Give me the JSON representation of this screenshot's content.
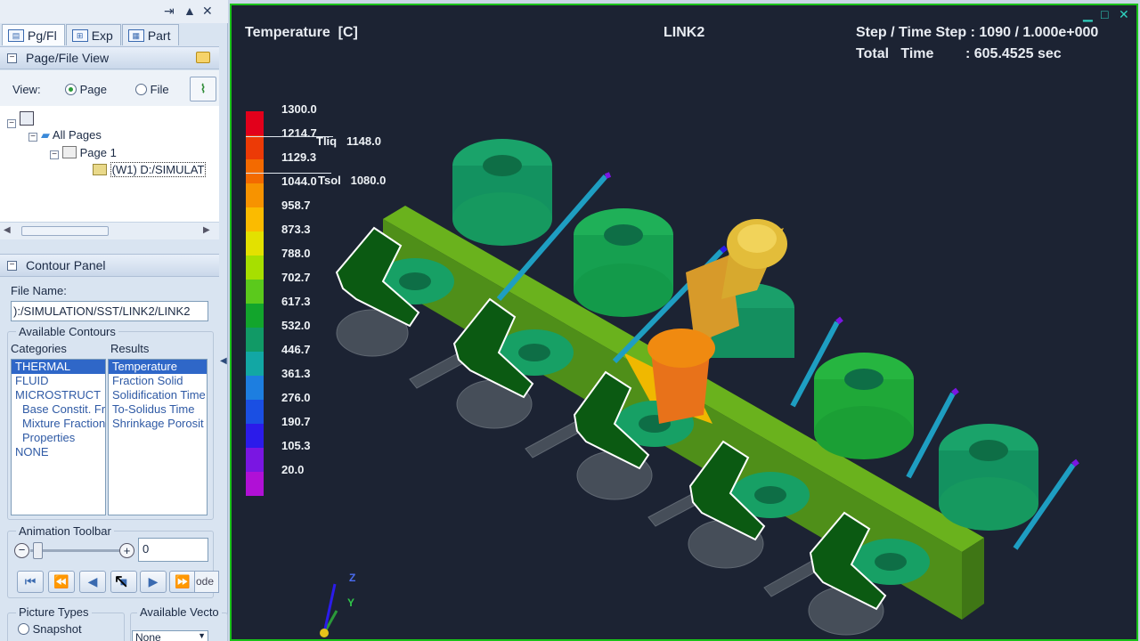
{
  "tabs": [
    "Pg/Fl",
    "Exp",
    "Part"
  ],
  "page_file_view": {
    "title": "Page/File View",
    "view_label": "View:",
    "radio_page": "Page",
    "radio_file": "File",
    "tree": {
      "all_pages": "All Pages",
      "page1": "Page 1",
      "file_node": "(W1) D:/SIMULAT"
    }
  },
  "contour_panel": {
    "title": "Contour Panel",
    "file_name_label": "File Name:",
    "file_name_value": "):/SIMULATION/SST/LINK2/LINK2",
    "available_contours": "Available Contours",
    "categories_label": "Categories",
    "results_label": "Results",
    "categories": [
      "THERMAL",
      "FLUID",
      "MICROSTRUCT",
      "Base Constit. Fr",
      "Mixture Fraction",
      "Properties",
      "NONE"
    ],
    "results": [
      "Temperature",
      "Fraction Solid",
      "Solidification Time",
      "To-Solidus Time",
      "Shrinkage Porosit"
    ]
  },
  "animation": {
    "title": "Animation Toolbar",
    "frame_value": "0",
    "mode_text": "ode"
  },
  "picture_types": {
    "title": "Picture Types",
    "snapshot": "Snapshot"
  },
  "available_vectors": {
    "title": "Available Vecto",
    "select_value": "None"
  },
  "viewport": {
    "quantity": "Temperature  [C]",
    "model": "LINK2",
    "step_line": "Step / Time Step : 1090 / 1.000e+000",
    "total_line": "Total   Time        : 605.4525 sec",
    "legend": [
      "1300.0",
      "1214.7",
      "1129.3",
      "1044.0",
      "958.7",
      "873.3",
      "788.0",
      "702.7",
      "617.3",
      "532.0",
      "446.7",
      "361.3",
      "276.0",
      "190.7",
      "105.3",
      "20.0"
    ],
    "tliq": "Tliq   1148.0",
    "tsol": "Tsol   1080.0",
    "axis_z": "Z",
    "axis_y": "Y"
  },
  "colors": {
    "legend_scale": [
      "#e2001b",
      "#ec3a06",
      "#f36a00",
      "#f79300",
      "#fbbb00",
      "#e3e100",
      "#a7df00",
      "#5bc91c",
      "#12a52c",
      "#119a66",
      "#12a7a4",
      "#1d7ee0",
      "#1a4fe3",
      "#2b1bea",
      "#7a16e2",
      "#b010d6"
    ],
    "viewport_border": "#19c219",
    "background": "#1c2333"
  }
}
